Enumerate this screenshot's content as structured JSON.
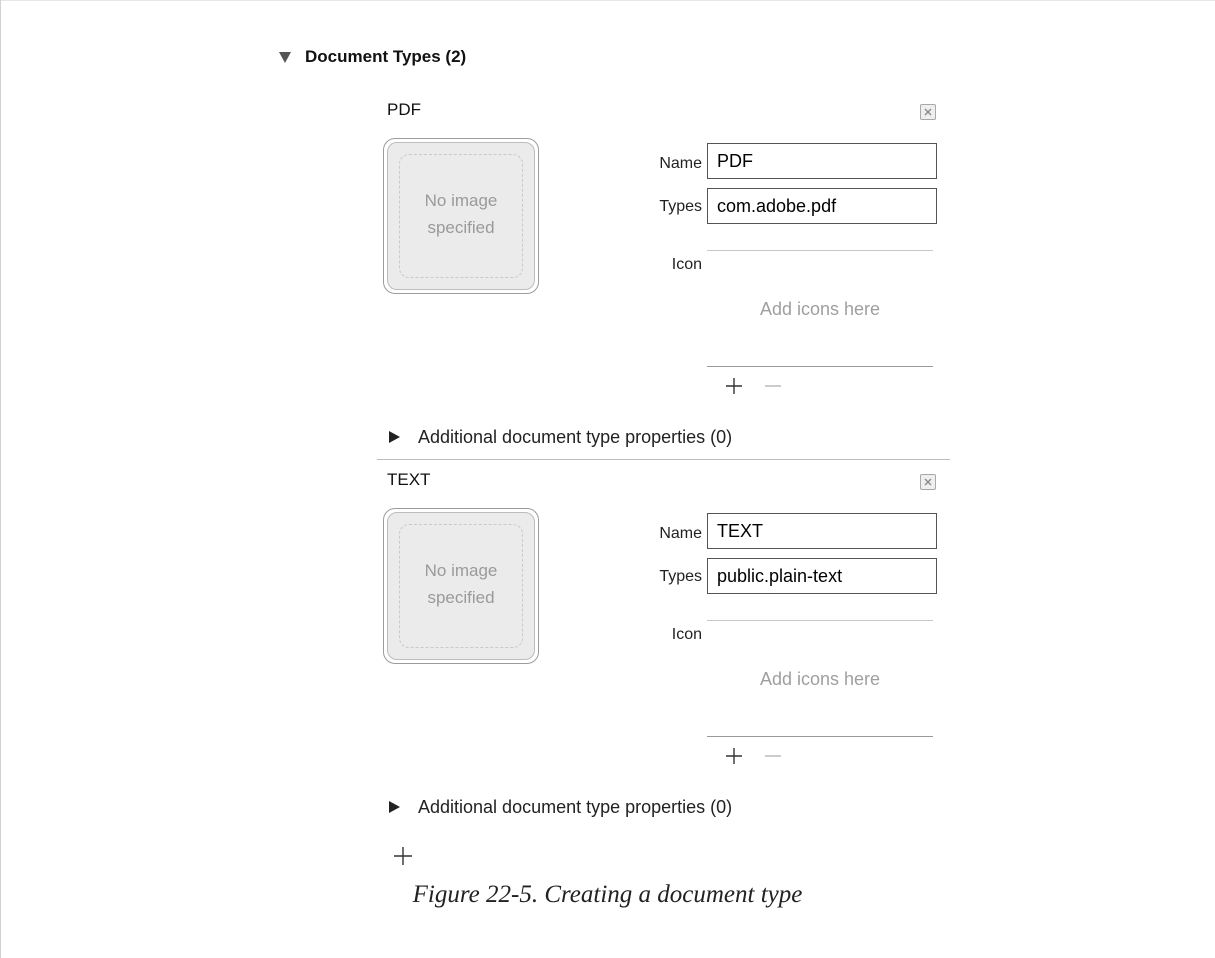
{
  "section": {
    "title": "Document Types (2)"
  },
  "documents": [
    {
      "title": "PDF",
      "image_well_text": "No image specified",
      "name_label": "Name",
      "name_value": "PDF",
      "types_label": "Types",
      "types_value": "com.adobe.pdf",
      "icon_label": "Icon",
      "icon_placeholder": "Add icons here",
      "additional_properties": "Additional document type properties (0)"
    },
    {
      "title": "TEXT",
      "image_well_text": "No image specified",
      "name_label": "Name",
      "name_value": "TEXT",
      "types_label": "Types",
      "types_value": "public.plain-text",
      "icon_label": "Icon",
      "icon_placeholder": "Add icons here",
      "additional_properties": "Additional document type properties (0)"
    }
  ],
  "caption": "Figure 22-5. Creating a document type",
  "colors": {
    "field_border": "#545454",
    "placeholder_text": "#9f9f9f",
    "divider": "#bcbcbc"
  }
}
